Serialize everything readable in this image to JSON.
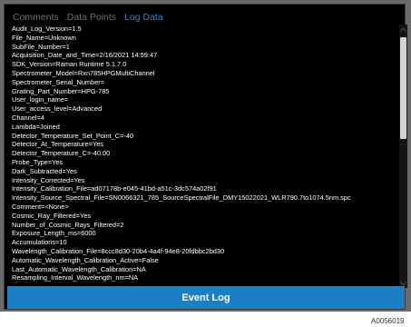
{
  "tabs": [
    {
      "label": "Comments",
      "active": false
    },
    {
      "label": "Data Points",
      "active": false
    },
    {
      "label": "Log Data",
      "active": true
    }
  ],
  "log_lines": [
    "Audit_Log_Version=1.5",
    "File_Name=Unknown",
    "SubFile_Number=1",
    "Acquisition_Date_and_Time=2/16/2021 14:59:47",
    "SDK_Version=Raman Runtime 5.1.7.0",
    "Spectrometer_Model=Rxn785HPGMultiChannel",
    "Spectrometer_Serial_Number=",
    "Grating_Part_Number=HPG-785",
    "User_login_name=",
    "User_access_level=Advanced",
    "Channel=4",
    "Lambda=Joined",
    "Detector_Temperature_Set_Point_C=-40",
    "Detector_At_Temperature=Yes",
    "Detector_Temperature_C=-40.00",
    "Probe_Type=Yes",
    "Dark_Subtracted=Yes",
    "Intensity_Corrected=Yes",
    "Intensity_Calibration_File=ad07178b-e045-41bd-a51c-3dc574a02f91",
    "Intensity_Source_Spectral_File=SN0066321_785_SourceSpectralFile_DMY15022021_WLR790.7to1074.5nm.spc",
    "Comment=<None>",
    "Cosmic_Ray_Filtered=Yes",
    "Number_of_Cosmic_Rays_Filtered=2",
    "Exposure_Length_ms=6000",
    "Accumulations=10",
    "Wavelength_Calibration_File=8ccc8d30-20b4-4a4f-94e8-20fdbbc2bd30",
    "Automatic_Wavelength_Calibration_Active=False",
    "Last_Automatic_Wavelength_Calibration=NA",
    "Resampling_Interval_Wavelength_nm=NA"
  ],
  "event_button_label": "Event Log",
  "figure_id": "A0056019",
  "colors": {
    "accent": "#1c7fc6",
    "active_tab": "#1e8ad6",
    "inactive_tab": "#6e6e6e",
    "log_text": "#ffffff",
    "panel_bg": "#000000"
  },
  "icons": {
    "scroll_up": "chevron-up-icon",
    "scroll_down": "chevron-down-icon"
  }
}
